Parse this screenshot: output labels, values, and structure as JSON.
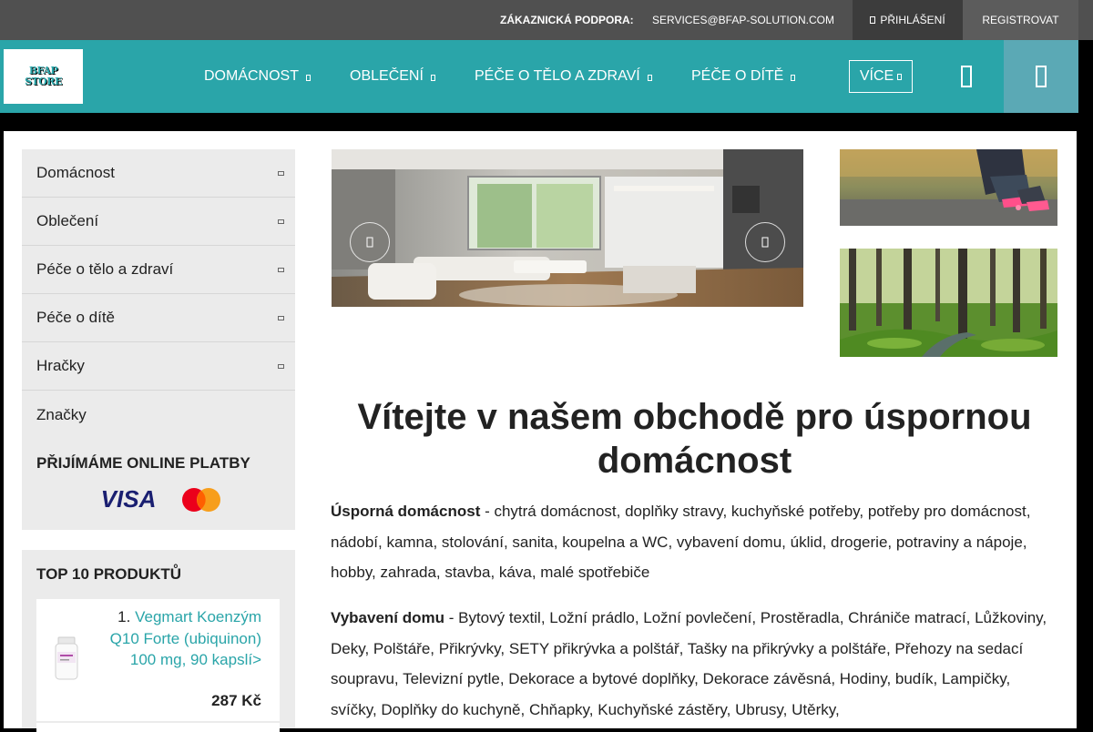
{
  "topbar": {
    "support_label": "ZÁKAZNICKÁ PODPORA:",
    "support_email": "SERVICES@BFAP-SOLUTION.COM",
    "login_label": "PŘIHLÁŠENÍ",
    "register_label": "REGISTROVAT"
  },
  "logo": {
    "line1": "BFAP",
    "line2": "STORE"
  },
  "nav": {
    "items": [
      {
        "label": "DOMÁCNOST"
      },
      {
        "label": "OBLEČENÍ"
      },
      {
        "label": "PÉČE O TĚLO A ZDRAVÍ"
      },
      {
        "label": "PÉČE O DÍTĚ"
      }
    ],
    "more_label": "VÍCE",
    "user_icon": "user-icon",
    "cart_icon": "cart-icon"
  },
  "sidebar": {
    "categories": [
      {
        "label": "Domácnost",
        "expandable": true
      },
      {
        "label": "Oblečení",
        "expandable": true
      },
      {
        "label": "Péče o tělo a zdraví",
        "expandable": true
      },
      {
        "label": "Péče o dítě",
        "expandable": true
      },
      {
        "label": "Hračky",
        "expandable": true
      },
      {
        "label": "Značky",
        "expandable": false
      }
    ],
    "payments_title": "PŘIJÍMÁME ONLINE PLATBY",
    "visa_label": "VISA",
    "top_title": "TOP 10 PRODUKTŮ",
    "top_products": [
      {
        "rank": "1.",
        "name": "Vegmart Koenzým Q10 Forte (ubiquinon) 100 mg, 90 kapslí>",
        "price": "287 Kč"
      }
    ]
  },
  "content": {
    "welcome_title": "Vítejte v našem obchodě pro úspornou domácnost",
    "p1_bold": "Úsporná domácnost",
    "p1_text": " - chytrá domácnost, doplňky stravy, kuchyňské potřeby, potřeby pro domácnost, nádobí, kamna, stolování, sanita, koupelna a WC, vybavení domu, úklid, drogerie, potraviny a nápoje, hobby, zahrada, stavba, káva, malé spotřebiče",
    "p2_bold": "Vybavení domu",
    "p2_text": " - Bytový textil, Ložní prádlo, Ložní povlečení, Prostěradla, Chrániče matrací, Lůžkoviny, Deky, Polštáře, Přikrývky, SETY přikrývka a polštář, Tašky na přikrývky a polštáře, Přehozy na sedací soupravu, Televizní pytle, Dekorace a bytové doplňky, Dekorace závěsná, Hodiny, budík, Lampičky, svíčky, Doplňky do kuchyně, Chňapky, Kuchyňské zástěry, Ubrusy, Utěrky,"
  },
  "colors": {
    "teal": "#2aa5a9",
    "topbar": "#505050",
    "sidebar_bg": "#ebebeb"
  }
}
